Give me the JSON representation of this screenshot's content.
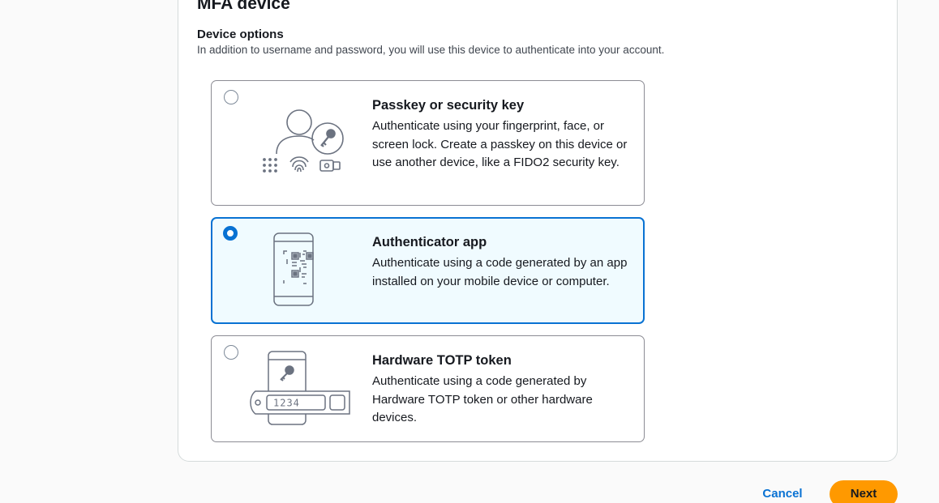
{
  "header": {
    "title": "MFA device"
  },
  "device_options": {
    "label": "Device options",
    "description": "In addition to username and password, you will use this device to authenticate into your account."
  },
  "options": [
    {
      "title": "Passkey or security key",
      "description": "Authenticate using your fingerprint, face, or screen lock. Create a passkey on this device or use another device, like a FIDO2 security key.",
      "selected": false,
      "icon": "passkey-illustration"
    },
    {
      "title": "Authenticator app",
      "description": "Authenticate using a code generated by an app installed on your mobile device or computer.",
      "selected": true,
      "icon": "authenticator-app-illustration"
    },
    {
      "title": "Hardware TOTP token",
      "description": "Authenticate using a code generated by Hardware TOTP token or other hardware devices.",
      "selected": false,
      "icon": "hardware-token-illustration",
      "token_display": "1234"
    }
  ],
  "footer": {
    "cancel_label": "Cancel",
    "next_label": "Next"
  },
  "colors": {
    "accent": "#0972d3",
    "primary_button": "#ff9900",
    "selected_background": "#f0fbff"
  }
}
